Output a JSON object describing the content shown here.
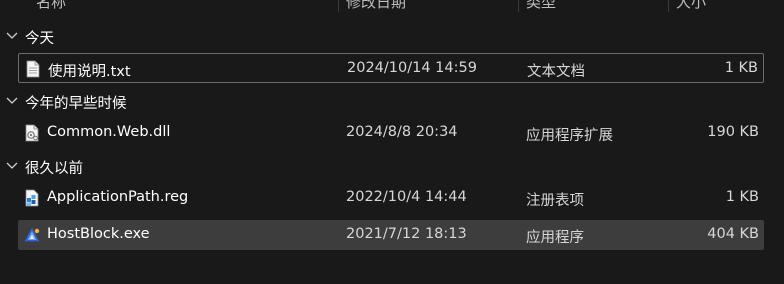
{
  "columns": {
    "name": "名称",
    "modified": "修改日期",
    "type": "类型",
    "size": "大小"
  },
  "groups": [
    {
      "label": "今天",
      "files": [
        {
          "name": "使用说明.txt",
          "date": "2024/10/14 14:59",
          "type": "文本文档",
          "size": "1 KB",
          "icon": "text-file-icon"
        }
      ]
    },
    {
      "label": "今年的早些时候",
      "files": [
        {
          "name": "Common.Web.dll",
          "date": "2024/8/8 20:34",
          "type": "应用程序扩展",
          "size": "190 KB",
          "icon": "dll-file-icon"
        }
      ]
    },
    {
      "label": "很久以前",
      "files": [
        {
          "name": "ApplicationPath.reg",
          "date": "2022/10/4 14:44",
          "type": "注册表项",
          "size": "1 KB",
          "icon": "registry-file-icon"
        },
        {
          "name": "HostBlock.exe",
          "date": "2021/7/12 18:13",
          "type": "应用程序",
          "size": "404 KB",
          "icon": "exe-file-icon"
        }
      ]
    }
  ],
  "colors": {
    "background": "#191919",
    "selected_row": "#3d3d3d",
    "focus_border": "#6a6a6a"
  }
}
